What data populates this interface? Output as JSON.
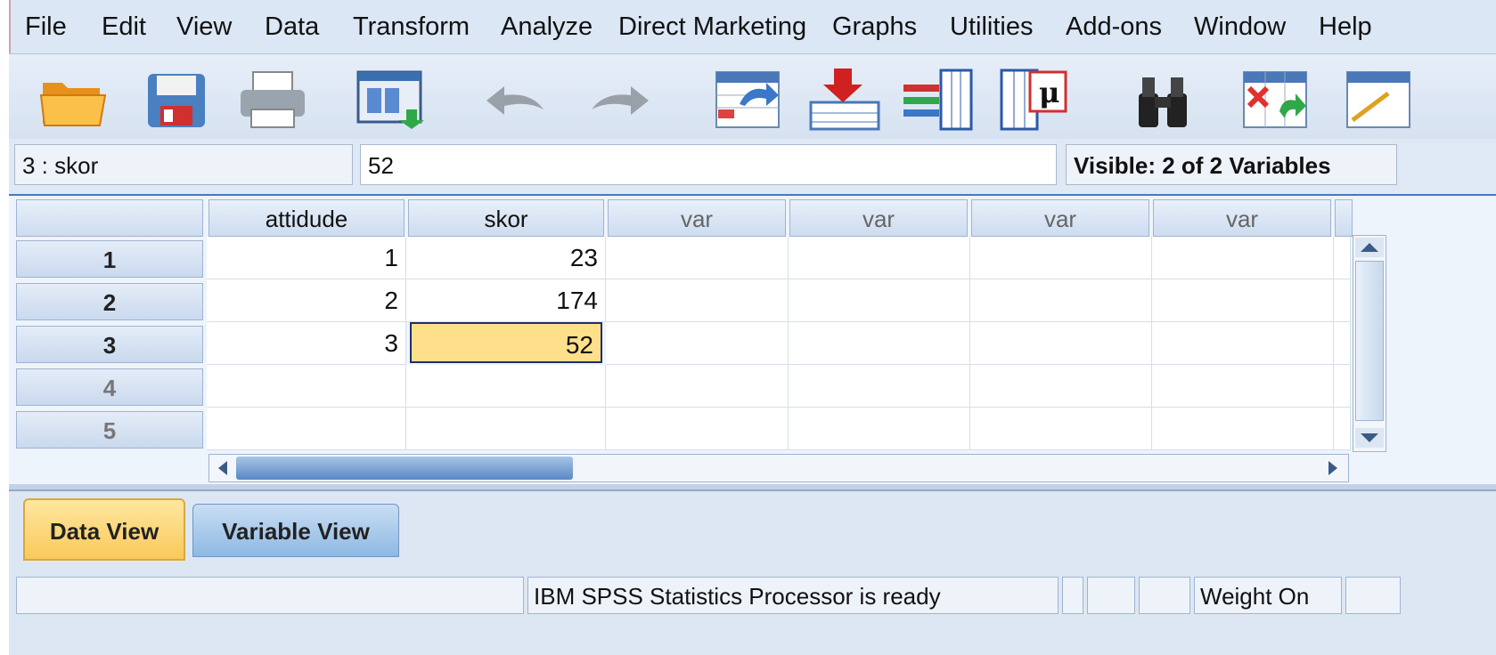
{
  "menu": [
    {
      "label": "File"
    },
    {
      "label": "Edit"
    },
    {
      "label": "View"
    },
    {
      "label": "Data"
    },
    {
      "label": "Transform"
    },
    {
      "label": "Analyze"
    },
    {
      "label": "Direct Marketing"
    },
    {
      "label": "Graphs"
    },
    {
      "label": "Utilities"
    },
    {
      "label": "Add-ons"
    },
    {
      "label": "Window"
    },
    {
      "label": "Help"
    }
  ],
  "toolbar": {
    "icons": [
      "open-folder-icon",
      "save-icon",
      "print-icon",
      "dialog-recall-icon",
      "undo-icon",
      "redo-icon",
      "goto-case-icon",
      "insert-cases-icon",
      "insert-variable-icon",
      "variables-icon",
      "find-icon",
      "split-file-icon",
      "weight-cases-icon"
    ],
    "mu_symbol": "μ"
  },
  "editbar": {
    "cell_ref": "3 : skor",
    "cell_value": "52",
    "visible": "Visible: 2 of 2 Variables"
  },
  "grid": {
    "columns": [
      "attidude",
      "skor",
      "var",
      "var",
      "var",
      "var"
    ],
    "rows": [
      {
        "num": "1",
        "attidude": "1",
        "skor": "23"
      },
      {
        "num": "2",
        "attidude": "2",
        "skor": "174"
      },
      {
        "num": "3",
        "attidude": "3",
        "skor": "52"
      },
      {
        "num": "4",
        "attidude": "",
        "skor": ""
      },
      {
        "num": "5",
        "attidude": "",
        "skor": ""
      }
    ],
    "selected_row": 3,
    "selected_col": "skor"
  },
  "tabs": {
    "data_view": "Data View",
    "variable_view": "Variable View",
    "active": "Data View"
  },
  "status": {
    "processor": "IBM SPSS Statistics Processor is ready",
    "weight": "Weight On"
  },
  "colors": {
    "selected_cell": "#ffe08a",
    "active_tab": "#ffd56b",
    "inactive_tab": "#9ec4e8"
  }
}
